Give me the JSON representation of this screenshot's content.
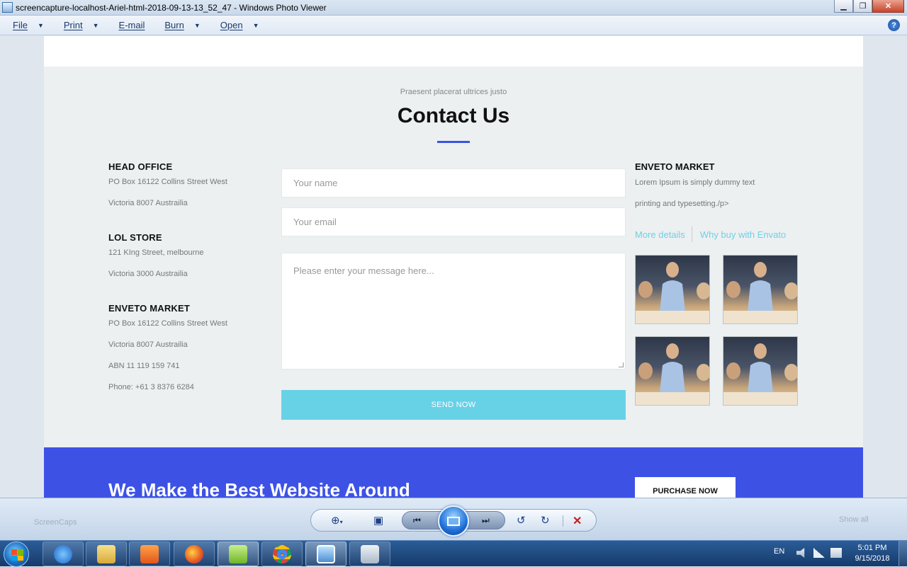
{
  "window": {
    "title": "screencapture-localhost-Ariel-html-2018-09-13-13_52_47 - Windows Photo Viewer",
    "minimize": "▁",
    "maximize": "❐",
    "close": "✕"
  },
  "menu": {
    "items": [
      {
        "label": "File",
        "has_dropdown": true
      },
      {
        "label": "Print",
        "has_dropdown": true
      },
      {
        "label": "E-mail",
        "has_dropdown": false
      },
      {
        "label": "Burn",
        "has_dropdown": true
      },
      {
        "label": "Open",
        "has_dropdown": true
      }
    ],
    "help_glyph": "?"
  },
  "contact": {
    "kicker": "Praesent placerat ultrices justo",
    "heading": "Contact Us",
    "accent_color": "#3a55e0",
    "offices": [
      {
        "title": "HEAD OFFICE",
        "lines": [
          "PO Box 16122 Collins Street West",
          "Victoria 8007 Austrailia"
        ]
      },
      {
        "title": "LOL STORE",
        "lines": [
          "121 KIng Street, melbourne",
          "Victoria 3000 Austrailia"
        ]
      },
      {
        "title": "ENVETO MARKET",
        "lines": [
          "PO Box 16122 Collins Street West",
          "Victoria 8007 Austrailia",
          "ABN 11 119 159 741",
          "Phone: +61 3 8376 6284"
        ]
      }
    ],
    "form": {
      "name_placeholder": "Your name",
      "email_placeholder": "Your email",
      "message_placeholder": "Please enter your message here...",
      "submit_label": "SEND NOW",
      "submit_color": "#67d1e6"
    },
    "aside": {
      "title": "ENVETO MARKET",
      "lines": [
        "Lorem Ipsum is simply dummy text",
        "printing and typesetting./p>"
      ],
      "links": [
        "More details",
        "Why buy with Envato"
      ],
      "link_color": "#6fd0e6",
      "thumbnail_count": 4
    }
  },
  "banner": {
    "title": "We Make the Best Website Around",
    "button": "PURCHASE NOW",
    "color": "#3d52e5"
  },
  "viewer_toolbar": {
    "icons": [
      "zoom-icon",
      "actual-size-icon",
      "previous-icon",
      "slideshow-icon",
      "next-icon",
      "rotate-left-icon",
      "rotate-right-icon",
      "delete-icon"
    ],
    "ghost_left": "ScreenCaps",
    "ghost_right": "Show all"
  },
  "taskbar": {
    "apps": [
      "internet-explorer",
      "file-explorer",
      "media-player",
      "firefox",
      "notepad-plus-plus",
      "chrome",
      "photo-viewer",
      "calculator"
    ],
    "language": "EN",
    "time": "5:01 PM",
    "date": "9/15/2018"
  }
}
